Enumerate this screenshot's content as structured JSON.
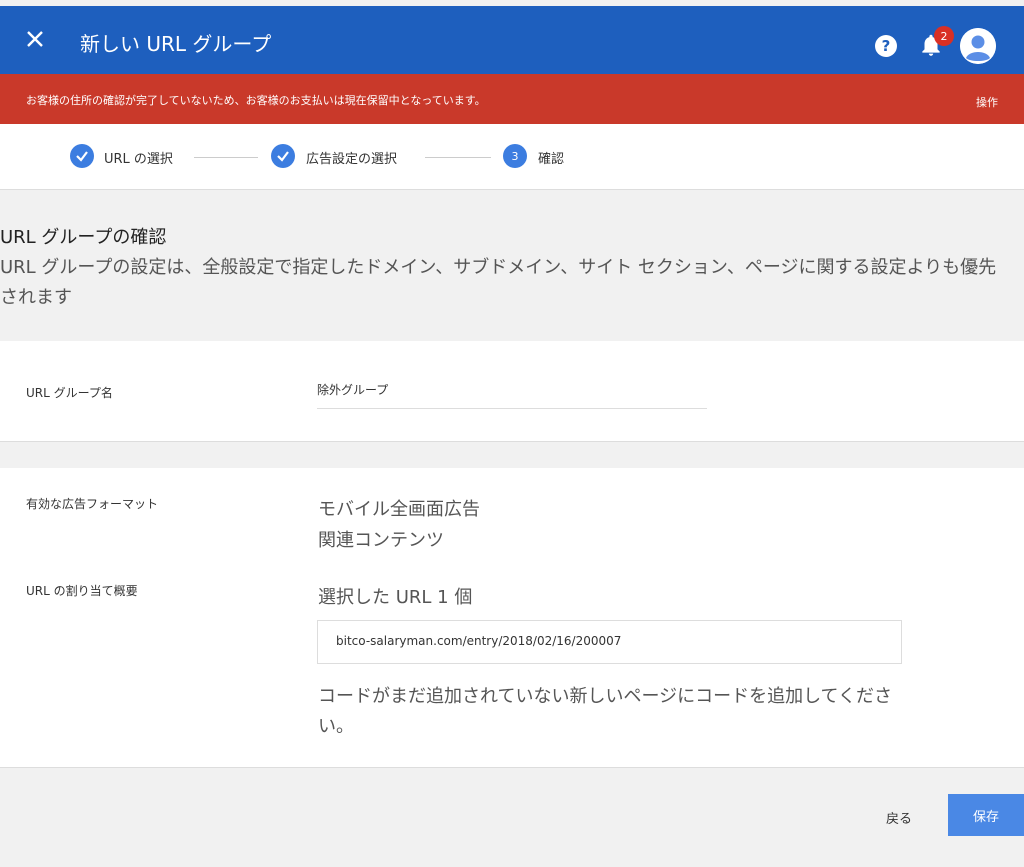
{
  "header": {
    "title": "新しい URL グループ",
    "notification_count": "2"
  },
  "alert": {
    "message": "お客様の住所の確認が完了していないため、お客様のお支払いは現在保留中となっています。",
    "action_label": "操作"
  },
  "stepper": {
    "steps": [
      {
        "label": "URL の選択",
        "status": "done"
      },
      {
        "label": "広告設定の選択",
        "status": "done"
      },
      {
        "number": "3",
        "label": "確認",
        "status": "current"
      }
    ]
  },
  "section": {
    "title": "URL グループの確認",
    "description": "URL グループの設定は、全般設定で指定したドメイン、サブドメイン、サイト セクション、ページに関する設定よりも優先されます"
  },
  "group_name": {
    "label": "URL グループ名",
    "value": "除外グループ"
  },
  "ad_formats": {
    "label": "有効な広告フォーマット",
    "items": [
      "モバイル全画面広告",
      "関連コンテンツ"
    ]
  },
  "url_assignment": {
    "label": "URL の割り当て概要",
    "summary": "選択した URL 1 個",
    "urls": [
      "bitco-salaryman.com/entry/2018/02/16/200007"
    ],
    "note": "コードがまだ追加されていない新しいページにコードを追加してください。"
  },
  "footer": {
    "back_label": "戻る",
    "save_label": "保存"
  },
  "colors": {
    "appbar": "#1e5fbe",
    "alert": "#c9392a",
    "step_icon": "#3c7de0",
    "save_button": "#4a88e5"
  },
  "icons": {
    "close": "close-icon",
    "help": "help-icon",
    "notifications": "bell-icon",
    "avatar": "account-avatar-icon",
    "check": "check-icon"
  }
}
